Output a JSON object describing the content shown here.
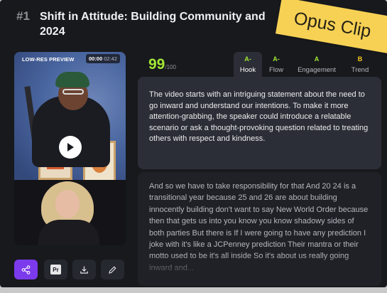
{
  "clip": {
    "rank": "#1",
    "title": "Shift in Attitude: Building Community and",
    "title_line2": "2024",
    "ribbon_text": "Opus Clip"
  },
  "video": {
    "tag": "LOW-RES PREVIEW",
    "current_time": "00:00",
    "total_time": "02:42"
  },
  "score": {
    "value": "99",
    "denominator": "/100",
    "color": "#a3e635"
  },
  "metrics": [
    {
      "grade": "A-",
      "label": "Hook",
      "color": "#a3e635",
      "active": true
    },
    {
      "grade": "A-",
      "label": "Flow",
      "color": "#a3e635",
      "active": false
    },
    {
      "grade": "A",
      "label": "Engagement",
      "color": "#a3e635",
      "active": false
    },
    {
      "grade": "B",
      "label": "Trend",
      "color": "#facc15",
      "active": false
    }
  ],
  "analysis": "The video starts with an intriguing statement about the need to go inward and understand our intentions. To make it more attention-grabbing, the speaker could introduce a relatable scenario or ask a thought-provoking question related to treating others with respect and kindness.",
  "transcript": "And so we have to take responsibility for that And 20 24 is a transitional year because 25 and 26 are about building innocently building don't want to say New World Order because then that gets us into you know you know shadowy sides of both parties But there is If I were going to have any prediction I joke with it's like a JCPenney prediction Their mantra or their motto used to be it's all inside So it's about us really going inward and...",
  "actions": {
    "share_icon": "share-icon",
    "premiere_label": "Pr",
    "download_icon": "download-icon",
    "edit_icon": "pencil-icon"
  },
  "colors": {
    "accent": "#7c3aed",
    "background": "#17191d",
    "panel": "#2b2e36",
    "ribbon": "#f7d154"
  }
}
